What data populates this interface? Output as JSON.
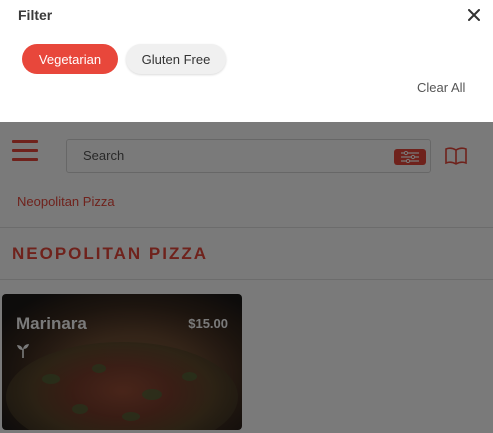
{
  "filter": {
    "title": "Filter",
    "close_icon": "close-icon",
    "chips": [
      {
        "label": "Vegetarian",
        "selected": true
      },
      {
        "label": "Gluten Free",
        "selected": false
      }
    ],
    "clear_all_label": "Clear All"
  },
  "header": {
    "menu_icon": "hamburger-menu-icon",
    "search": {
      "placeholder": "Search",
      "value": ""
    },
    "filter_icon": "sliders-icon",
    "book_icon": "open-book-icon"
  },
  "breadcrumb": {
    "label": "Neopolitan Pizza"
  },
  "section": {
    "title": "NEOPOLITAN PIZZA"
  },
  "items": [
    {
      "name": "Marinara",
      "price": "$15.00",
      "icon": "vegetarian-sprout-icon"
    }
  ],
  "colors": {
    "accent": "#e8473b",
    "overlay": "rgba(0,0,0,0.52)",
    "chip_inactive": "#f0f0f0"
  }
}
